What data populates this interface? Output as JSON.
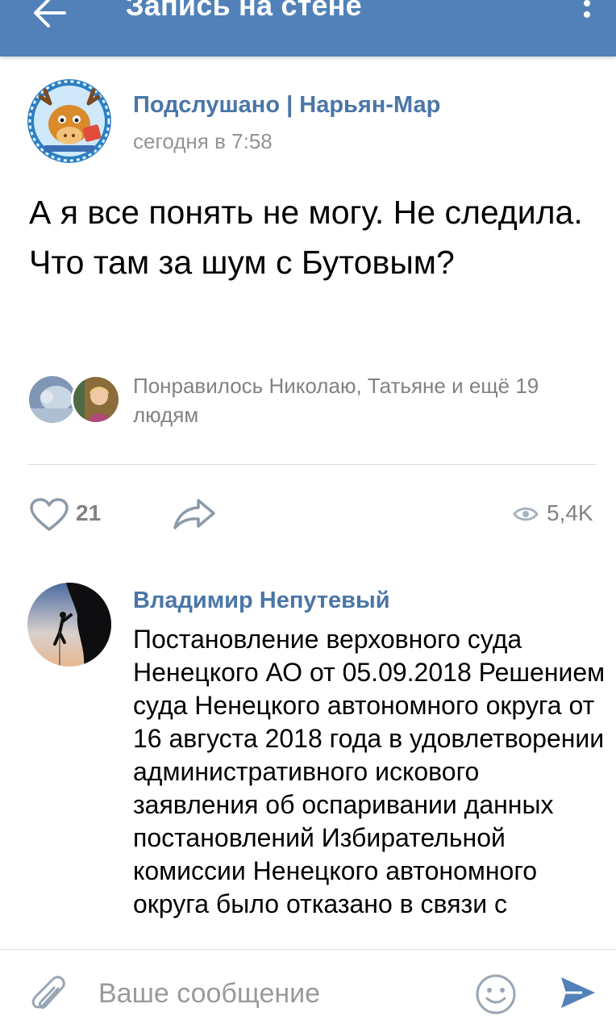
{
  "header": {
    "title": "Запись на стене",
    "back_icon": "arrow-left-icon",
    "menu_icon": "more-vertical-icon",
    "bar_color": "#5181b8"
  },
  "post": {
    "group_name": "Подслушано | Нарьян-Мар",
    "time": "сегодня в 7:58",
    "text": "А я все понять не могу. Не следила. Что там за шум с Бутовым?",
    "liked_by": "Понравилось Николаю, Татьяне и ещё 19 людям",
    "likes_count": "21",
    "views_count": "5,4K",
    "link_color": "#4a76a8"
  },
  "comment": {
    "author": "Владимир Непутевый",
    "text": "Постановление верховного суда Ненецкого АО от 05.09.2018 Решением суда Ненецкого автономного округа от 16 августа 2018 года в удовлетворении административного искового заявления об оспаривании данных постановлений Избирательной комиссии Ненецкого автономного округа было отказано в связи с"
  },
  "composer": {
    "placeholder": "Ваше сообщение",
    "value": "",
    "attach_icon": "paperclip-icon",
    "emoji_icon": "smile-icon",
    "send_icon": "send-icon"
  }
}
